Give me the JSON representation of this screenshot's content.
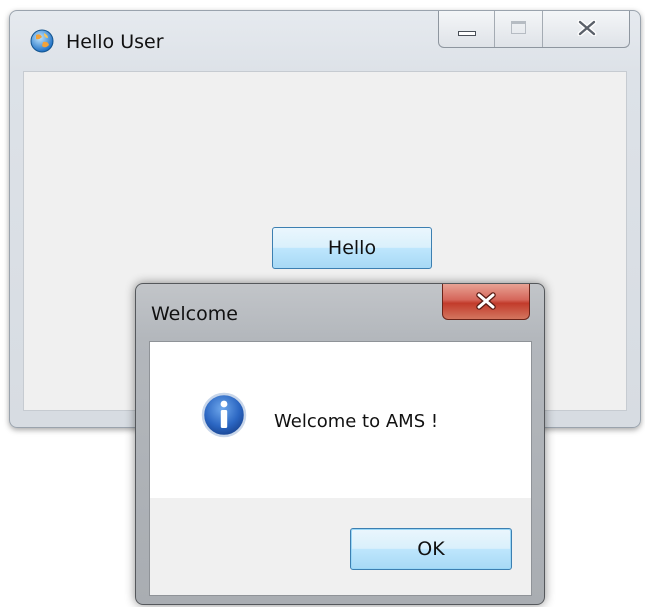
{
  "main_window": {
    "title": "Hello User",
    "icon": "app-globe-icon",
    "caption_buttons": [
      "minimize-icon",
      "maximize-icon",
      "close-icon"
    ],
    "hello_button_label": "Hello"
  },
  "dialog": {
    "title": "Welcome",
    "icon": "info-icon",
    "message": "Welcome to AMS !",
    "ok_button_label": "OK",
    "close_button": "close-icon"
  },
  "colors": {
    "button_border": "#3c7fb1",
    "button_fill": "#bee6fd",
    "close_red": "#c23b2b",
    "info_blue": "#1f5cb0"
  }
}
